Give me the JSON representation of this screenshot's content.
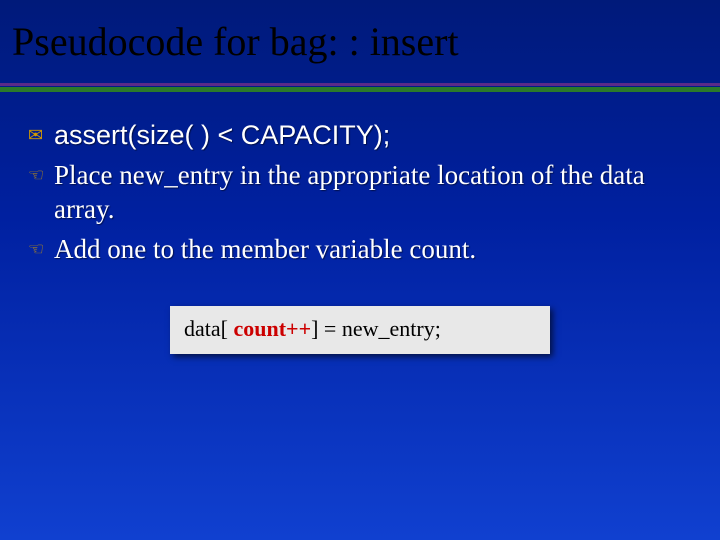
{
  "title": "Pseudocode for bag: : insert",
  "bullets": [
    {
      "icon": "✉",
      "iconName": "envelope-icon",
      "text": "assert(size( ) < CAPACITY);"
    },
    {
      "icon": "☜",
      "iconName": "hand-left-icon",
      "text": "Place new_entry in the appropriate location of the data array."
    },
    {
      "icon": "☜",
      "iconName": "hand-left-icon",
      "text": "Add one to the member variable count."
    }
  ],
  "code": {
    "p1": "data[ ",
    "highlight": "count++",
    "p2": "]  = new_entry;"
  }
}
